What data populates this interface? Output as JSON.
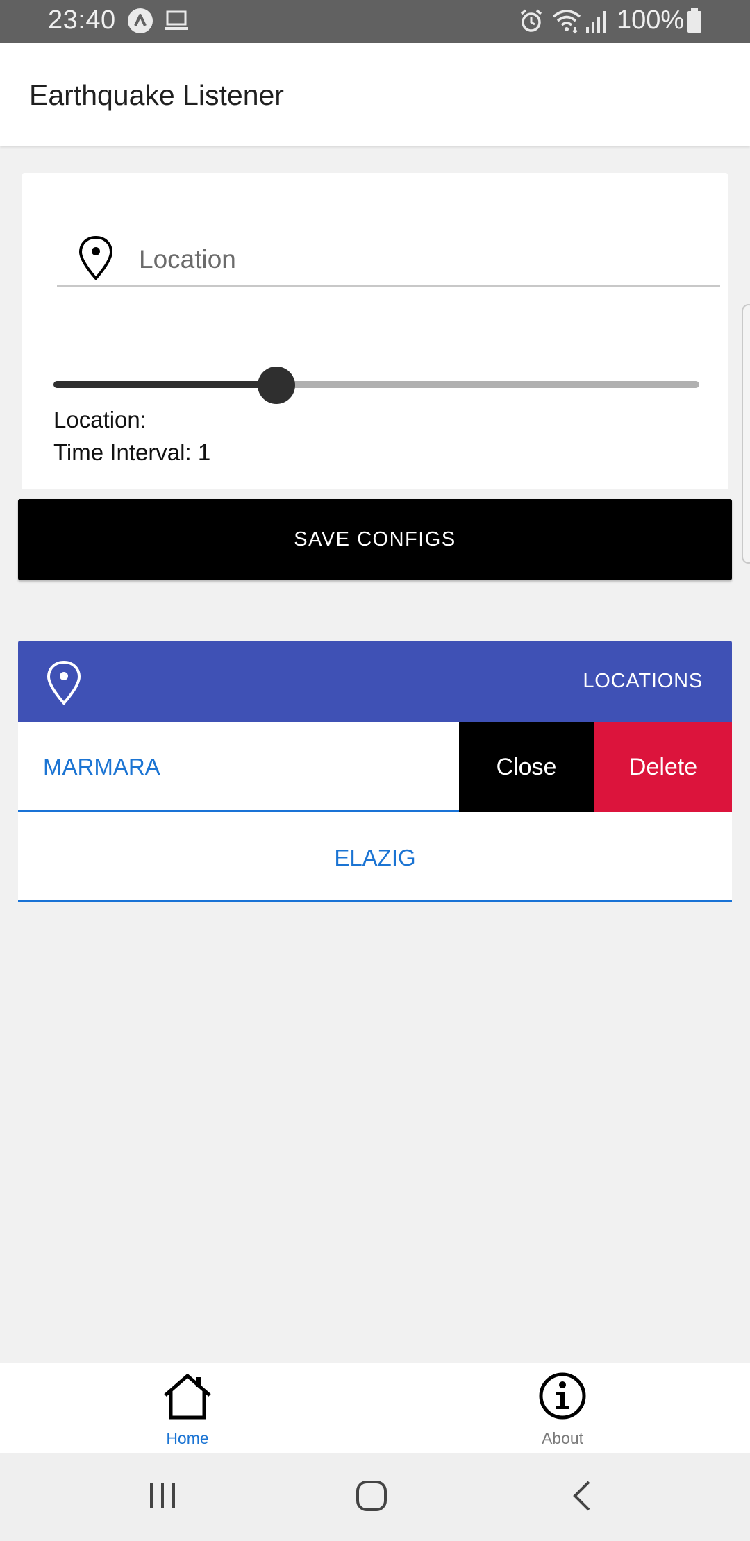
{
  "status_bar": {
    "time": "23:40",
    "battery_percent": "100%",
    "icons": [
      "expo-icon",
      "laptop-icon",
      "alarm-icon",
      "wifi-icon",
      "signal-icon",
      "battery-icon"
    ]
  },
  "app_bar": {
    "title": "Earthquake Listener"
  },
  "config": {
    "location_placeholder": "Location",
    "location_value": "",
    "slider_fraction": 0.345,
    "location_line": "Location:",
    "time_interval_line": "Time Interval: 1"
  },
  "save_button": {
    "label": "SAVE CONFIGS"
  },
  "locations": {
    "header_label": "LOCATIONS",
    "items": [
      {
        "name": "MARMARA"
      },
      {
        "name": "ELAZIG"
      }
    ],
    "swipe_actions": {
      "close_label": "Close",
      "delete_label": "Delete"
    }
  },
  "tabs": [
    {
      "label": "Home",
      "icon": "home-icon",
      "active": true
    },
    {
      "label": "About",
      "icon": "info-icon",
      "active": false
    }
  ],
  "colors": {
    "header_blue": "#3f51b5",
    "link_blue": "#1b74d3",
    "delete_red": "#dc143c",
    "save_black": "#000000"
  }
}
